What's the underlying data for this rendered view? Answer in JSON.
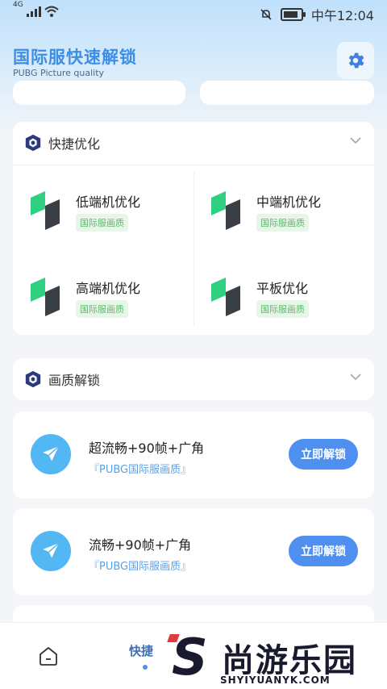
{
  "status_bar": {
    "network": "4G",
    "time": "中午12:04"
  },
  "header": {
    "title": "国际服快速解锁",
    "subtitle": "PUBG Picture quality",
    "settings_icon": "gear-icon"
  },
  "quick_opt": {
    "title": "快捷优化",
    "items": [
      {
        "name": "低端机优化",
        "tag": "国际服画质"
      },
      {
        "name": "中端机优化",
        "tag": "国际服画质"
      },
      {
        "name": "高端机优化",
        "tag": "国际服画质"
      },
      {
        "name": "平板优化",
        "tag": "国际服画质"
      }
    ]
  },
  "unlock": {
    "title": "画质解锁",
    "items": [
      {
        "name": "超流畅+90帧+广角",
        "tip": "『PUBG国际服画质』",
        "button": "立即解锁"
      },
      {
        "name": "流畅+90帧+广角",
        "tip": "『PUBG国际服画质』",
        "button": "立即解锁"
      }
    ]
  },
  "bottom_nav": {
    "active_label": "快捷"
  },
  "watermark": {
    "brand": "尚游乐园",
    "url": "SHYIYUANYK.COM"
  },
  "colors": {
    "accent": "#4f8ff0",
    "title": "#3e8ee6",
    "tag_green": "#5fb66f",
    "icon_green": "#2fd07f"
  }
}
